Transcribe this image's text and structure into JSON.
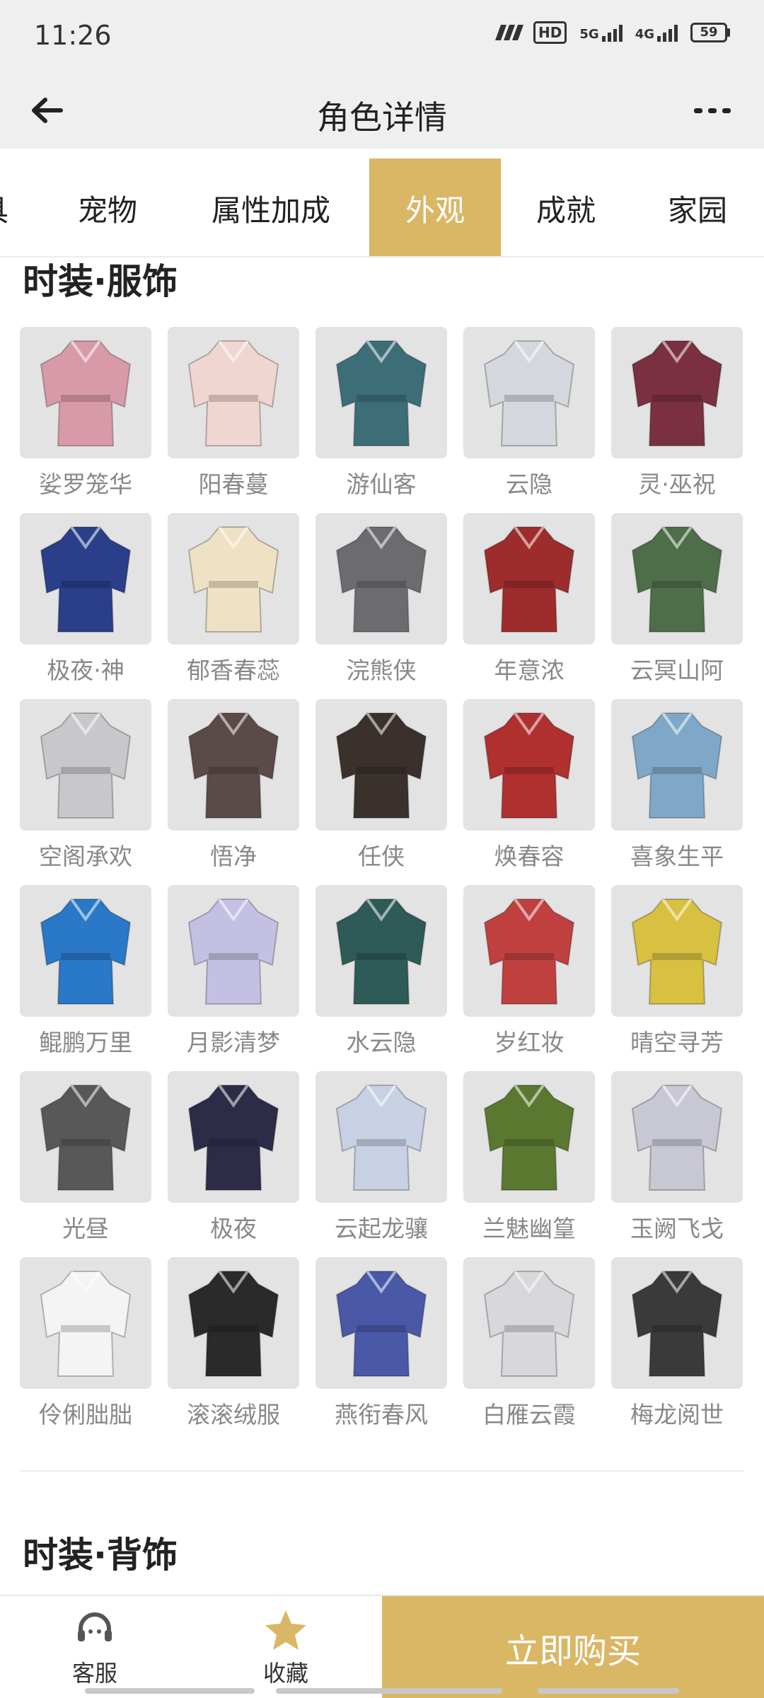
{
  "status_bar": {
    "time": "11:26",
    "network_hd": "HD",
    "net_5g": "5G",
    "net_4g": "4G",
    "battery": "59"
  },
  "header": {
    "title": "角色详情"
  },
  "tabs": [
    {
      "label": "具"
    },
    {
      "label": "宠物"
    },
    {
      "label": "属性加成"
    },
    {
      "label": "外观"
    },
    {
      "label": "成就"
    },
    {
      "label": "家园"
    }
  ],
  "active_tab": "外观",
  "sections": [
    {
      "title": "时装·服饰"
    },
    {
      "title": "时装·背饰"
    }
  ],
  "items": [
    {
      "name": "娑罗笼华",
      "color": "#d89aa8"
    },
    {
      "name": "阳春蔓",
      "color": "#f0d6d0"
    },
    {
      "name": "游仙客",
      "color": "#3d6e78"
    },
    {
      "name": "云隐",
      "color": "#d4d8de"
    },
    {
      "name": "灵·巫祝",
      "color": "#7a3040"
    },
    {
      "name": "极夜·神",
      "color": "#2a3e8a"
    },
    {
      "name": "郁香春蕊",
      "color": "#efe2c4"
    },
    {
      "name": "浣熊侠",
      "color": "#6c6c70"
    },
    {
      "name": "年意浓",
      "color": "#9e2c2c"
    },
    {
      "name": "云冥山阿",
      "color": "#4d6e48"
    },
    {
      "name": "空阁承欢",
      "color": "#c8c8cc"
    },
    {
      "name": "悟净",
      "color": "#5a4a48"
    },
    {
      "name": "任侠",
      "color": "#3a302c"
    },
    {
      "name": "焕春容",
      "color": "#b03030"
    },
    {
      "name": "喜象生平",
      "color": "#7fa8c8"
    },
    {
      "name": "鲲鹏万里",
      "color": "#2a78c8"
    },
    {
      "name": "月影清梦",
      "color": "#c4c0e4"
    },
    {
      "name": "水云隐",
      "color": "#2e5a58"
    },
    {
      "name": "岁红妆",
      "color": "#c04040"
    },
    {
      "name": "晴空寻芳",
      "color": "#d8c040"
    },
    {
      "name": "光昼",
      "color": "#585858"
    },
    {
      "name": "极夜",
      "color": "#2c2c48"
    },
    {
      "name": "云起龙骧",
      "color": "#c8d0e4"
    },
    {
      "name": "兰魅幽篁",
      "color": "#5a7830"
    },
    {
      "name": "玉阙飞戈",
      "color": "#c8c8d4"
    },
    {
      "name": "伶俐朏朏",
      "color": "#f4f4f4"
    },
    {
      "name": "滚滚绒服",
      "color": "#2a2a2a"
    },
    {
      "name": "燕衔春风",
      "color": "#4a58a8"
    },
    {
      "name": "白雁云霞",
      "color": "#d8d8dc"
    },
    {
      "name": "梅龙阅世",
      "color": "#3a3a3a"
    }
  ],
  "bottom_bar": {
    "service_label": "客服",
    "favorite_label": "收藏",
    "buy_label": "立即购买"
  },
  "colors": {
    "accent": "#dab765",
    "header_bg": "#efefef",
    "item_bg": "#e3e3e3",
    "item_label": "#888888"
  }
}
